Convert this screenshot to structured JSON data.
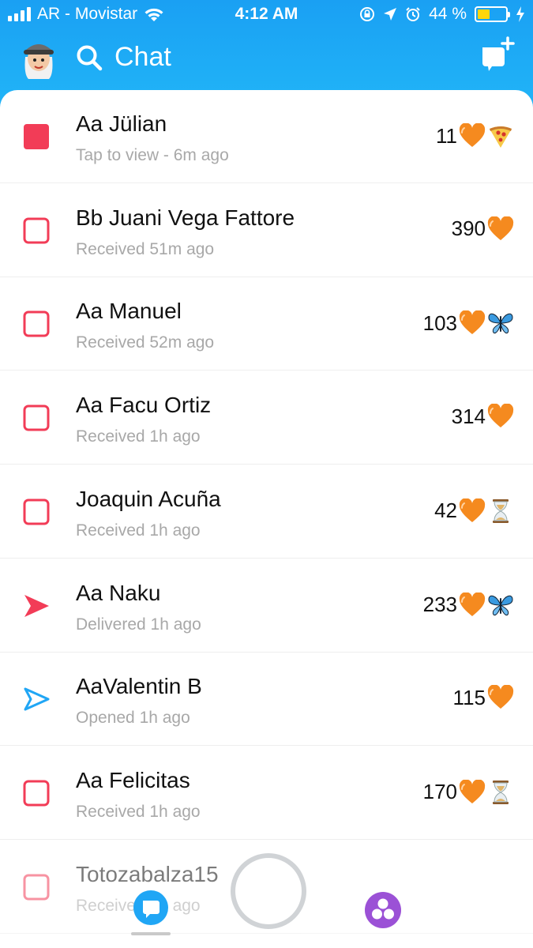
{
  "status_bar": {
    "carrier": "AR - Movistar",
    "time": "4:12 AM",
    "battery_percent": "44 %",
    "battery_level": 0.44
  },
  "header": {
    "title": "Chat",
    "icons": [
      "bitmoji-avatar",
      "search-icon",
      "new-chat-icon"
    ]
  },
  "colors": {
    "header_blue": "#20b2f7",
    "snap_red": "#f23c57",
    "chat_blue": "#20a6f5",
    "streak_orange": "#f58a1f",
    "discover_purple": "#9b51d6"
  },
  "chats": [
    {
      "name": "Aa Jülian",
      "sub": "Tap to view - 6m ago",
      "count": "11",
      "status": "new-snap",
      "emoji": "pizza"
    },
    {
      "name": "Bb Juani Vega Fattore",
      "sub": "Received 51m ago",
      "count": "390",
      "status": "received",
      "emoji": ""
    },
    {
      "name": "Aa Manuel",
      "sub": "Received 52m ago",
      "count": "103",
      "status": "received",
      "emoji": "butterfly"
    },
    {
      "name": "Aa Facu Ortiz",
      "sub": "Received 1h ago",
      "count": "314",
      "status": "received",
      "emoji": ""
    },
    {
      "name": "Joaquin Acuña",
      "sub": "Received 1h ago",
      "count": "42",
      "status": "received",
      "emoji": "hourglass"
    },
    {
      "name": "Aa Naku",
      "sub": "Delivered 1h ago",
      "count": "233",
      "status": "delivered",
      "emoji": "butterfly"
    },
    {
      "name": "AaValentin B",
      "sub": "Opened 1h ago",
      "count": "115",
      "status": "opened",
      "emoji": ""
    },
    {
      "name": "Aa Felicitas",
      "sub": "Received 1h ago",
      "count": "170",
      "status": "received",
      "emoji": "hourglass"
    },
    {
      "name": "Totozabalza15",
      "sub": "Received 1h ago",
      "count": "",
      "status": "received",
      "emoji": ""
    }
  ],
  "bottom_nav": {
    "items": [
      "chat-icon",
      "camera-button",
      "discover-icon"
    ]
  }
}
